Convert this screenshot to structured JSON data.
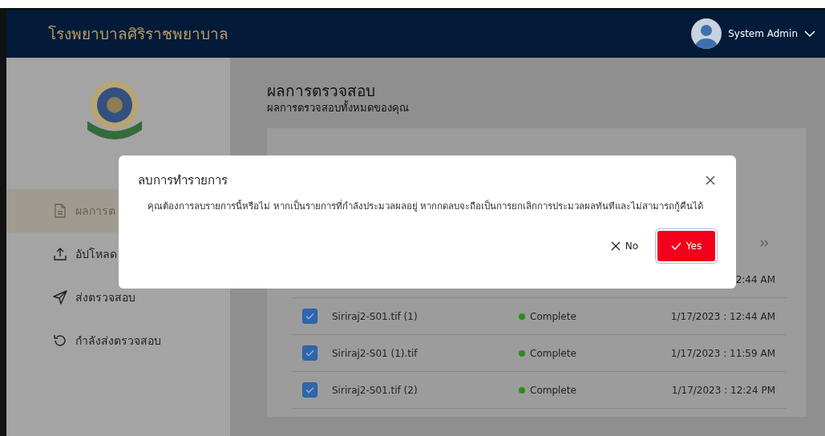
{
  "header": {
    "title": "โรงพยาบาลศิริราชพยาบาล",
    "user": "System Admin"
  },
  "sidebar": {
    "items": [
      {
        "label": "ผลการต",
        "kind": "document",
        "selected": true
      },
      {
        "label": "อัปโหลด",
        "kind": "upload",
        "selected": false
      },
      {
        "label": "ส่งตรวจสอบ",
        "kind": "send",
        "selected": false
      },
      {
        "label": "กำลังส่งตรวจสอบ",
        "kind": "refresh",
        "selected": false
      }
    ]
  },
  "page": {
    "title": "ผลการตรวจสอบ",
    "subtitle": "ผลการตรวจสอบทั้งหมดของคุณ"
  },
  "table": {
    "rows": [
      {
        "date": "2:44 AM"
      },
      {
        "checked": true,
        "name": "Siriraj2-S01.tif (1)",
        "status": "Complete",
        "color": "#2e8a1e",
        "date": "1/17/2023 : 12:44 AM"
      },
      {
        "checked": true,
        "name": "Siriraj2-S01 (1).tif",
        "status": "Complete",
        "color": "#2e8a1e",
        "date": "1/17/2023 : 11:59 AM"
      },
      {
        "checked": true,
        "name": "Siriraj2-S01.tif (2)",
        "status": "Complete",
        "color": "#2e8a1e",
        "date": "1/17/2023 : 12:24 PM"
      }
    ]
  },
  "dialog": {
    "title": "ลบการทำรายการ",
    "message": "คุณต้องการลบรายการนี้หรือไม่ หากเป็นรายการที่กำลังประมวลผลอยู่ หากกดลบจะถือเป็นการยกเลิกการประมวลผลทันทีและไม่สามารถกู้คืนได้",
    "buttons": [
      {
        "label": "No",
        "kind": "secondary"
      },
      {
        "label": "Yes",
        "kind": "primary"
      }
    ]
  }
}
